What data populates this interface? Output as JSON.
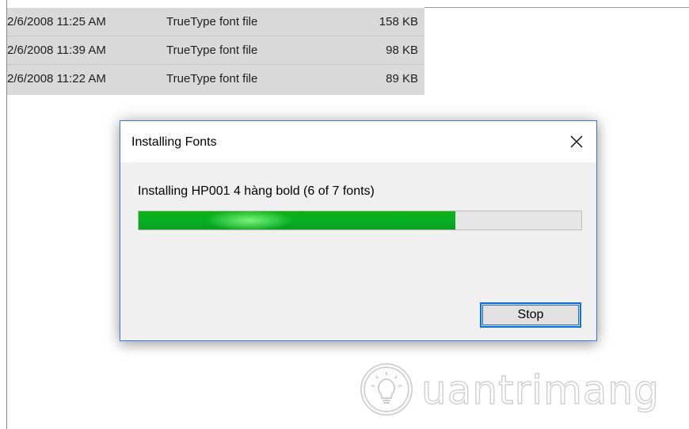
{
  "file_list": {
    "rows": [
      {
        "date": "2/6/2008 11:25 AM",
        "type": "TrueType font file",
        "size": "158 KB"
      },
      {
        "date": "2/6/2008 11:39 AM",
        "type": "TrueType font file",
        "size": "98 KB"
      },
      {
        "date": "2/6/2008 11:22 AM",
        "type": "TrueType font file",
        "size": "89 KB"
      }
    ]
  },
  "dialog": {
    "title": "Installing Fonts",
    "close_icon": "close-icon",
    "status": "Installing HP001 4 hàng bold (6 of 7 fonts)",
    "progress_fraction": 0.715,
    "progress_color": "#06b025",
    "stop_label": "Stop",
    "accent_color": "#0f6ed8"
  },
  "watermark": {
    "text": "uantrimang",
    "icon": "lightbulb-logo-icon"
  }
}
